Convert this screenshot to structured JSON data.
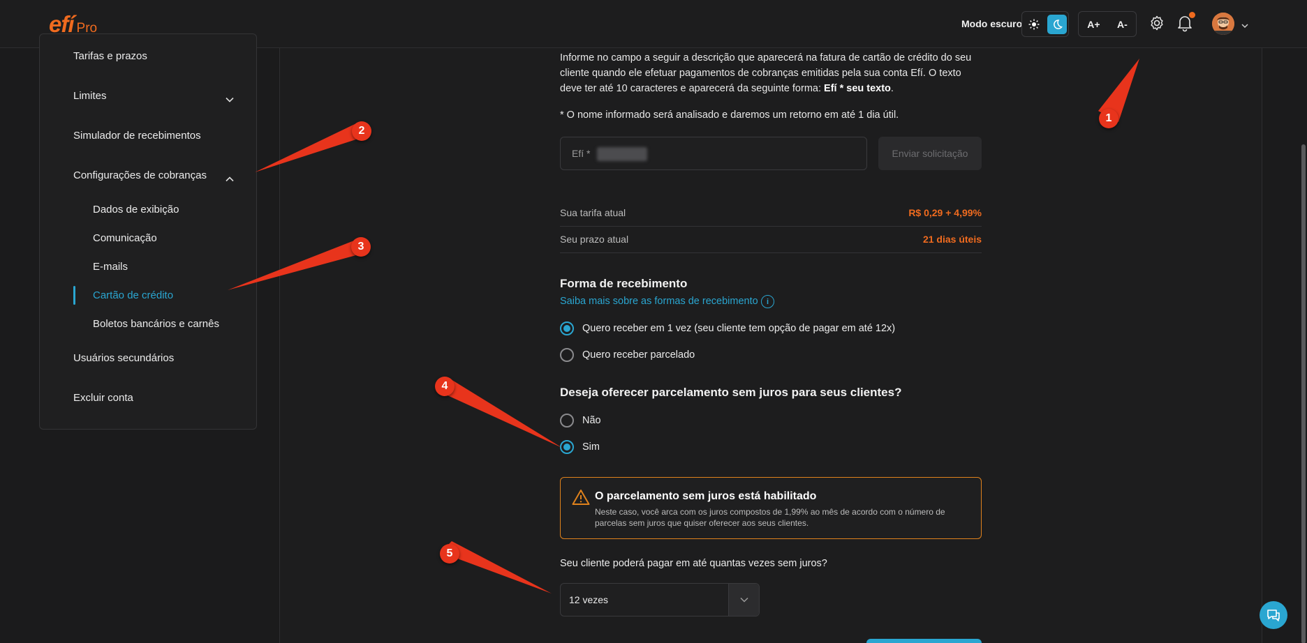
{
  "header": {
    "logo": "efí",
    "logo_sub": "Pro",
    "dark_mode_label": "Modo escuro",
    "font_increase": "A+",
    "font_decrease": "A-"
  },
  "sidebar": {
    "items": [
      {
        "label": "Tarifas e prazos"
      },
      {
        "label": "Limites"
      },
      {
        "label": "Simulador de recebimentos"
      },
      {
        "label": "Configurações de cobranças"
      },
      {
        "label": "Usuários secundários"
      },
      {
        "label": "Excluir conta"
      }
    ],
    "subitems": [
      {
        "label": "Dados de exibição"
      },
      {
        "label": "Comunicação"
      },
      {
        "label": "E-mails"
      },
      {
        "label": "Cartão de crédito"
      },
      {
        "label": "Boletos bancários e carnês"
      }
    ]
  },
  "main": {
    "desc_part1": "Informe no campo a seguir a descrição que aparecerá na fatura de cartão de crédito do seu cliente quando ele efetuar pagamentos de cobranças emitidas pela sua conta Efí. O texto deve ter até 10 caracteres e aparecerá da seguinte forma: ",
    "desc_bold": "Efí * seu texto",
    "desc_end": ".",
    "note": "* O nome informado será analisado e daremos um retorno em até 1 dia útil.",
    "input_prefix": "Efí *",
    "send_button": "Enviar solicitação",
    "rate_label": "Sua tarifa atual",
    "rate_value": "R$ 0,29 + 4,99%",
    "term_label": "Seu prazo atual",
    "term_value": "21 dias úteis",
    "receive_title": "Forma de recebimento",
    "receive_link": "Saiba mais sobre as formas de recebimento",
    "receive_options": [
      {
        "label": "Quero receber em 1 vez (seu cliente tem opção de pagar em até 12x)",
        "checked": true
      },
      {
        "label": "Quero receber parcelado",
        "checked": false
      }
    ],
    "installment_title": "Deseja oferecer parcelamento sem juros para seus clientes?",
    "installment_options": [
      {
        "label": "Não",
        "checked": false
      },
      {
        "label": "Sim",
        "checked": true
      }
    ],
    "alert_title": "O parcelamento sem juros está habilitado",
    "alert_text": "Neste caso, você arca com os juros compostos de 1,99% ao mês de acordo com o número de parcelas sem juros que quiser oferecer aos seus clientes.",
    "installments_question": "Seu cliente poderá pagar em até quantas vezes sem juros?",
    "installments_value": "12 vezes"
  },
  "annotations": [
    "1",
    "2",
    "3",
    "4",
    "5"
  ],
  "colors": {
    "accent": "#2aa6d1",
    "brand": "#f06b1f",
    "annotation": "#e8341c",
    "alert_border": "#e0821c"
  }
}
